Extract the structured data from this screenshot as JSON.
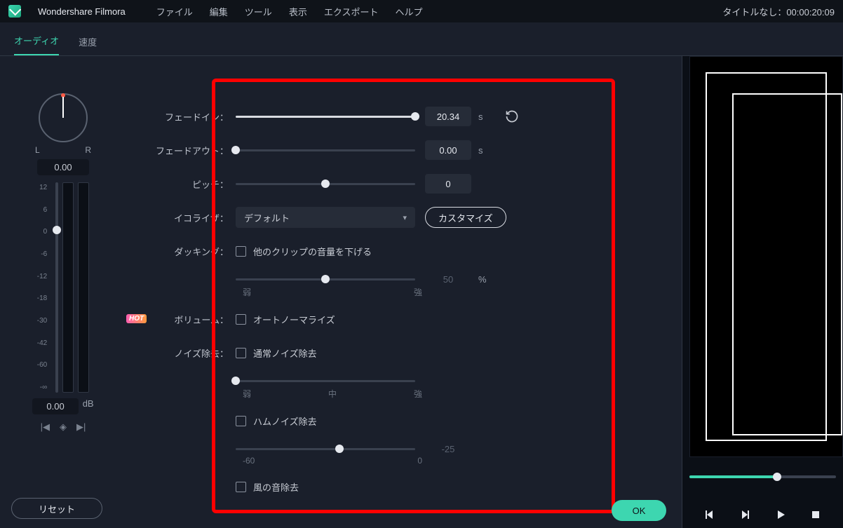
{
  "app": {
    "title": "Wondershare Filmora",
    "timecode": "タイトルなし：00:00:20:09"
  },
  "menu": {
    "file": "ファイル",
    "edit": "編集",
    "tool": "ツール",
    "view": "表示",
    "export": "エクスポート",
    "help": "ヘルプ"
  },
  "tabs": {
    "audio": "オーディオ",
    "speed": "速度"
  },
  "pan": {
    "l": "L",
    "r": "R",
    "value": "0.00"
  },
  "meter": {
    "ticks": [
      "12",
      "6",
      "0",
      "-6",
      "-12",
      "-18",
      "-30",
      "-42",
      "-60",
      "-∞"
    ],
    "value": "0.00",
    "unit": "dB"
  },
  "controls": {
    "fadein": {
      "label": "フェードイン：",
      "value": "20.34",
      "unit": "s"
    },
    "fadeout": {
      "label": "フェードアウト：",
      "value": "0.00",
      "unit": "s"
    },
    "pitch": {
      "label": "ピッチ：",
      "value": "0"
    },
    "equalizer": {
      "label": "イコライザ：",
      "value": "デフォルト",
      "customize": "カスタマイズ"
    },
    "ducking": {
      "label": "ダッキング：",
      "checkbox": "他のクリップの音量を下げる",
      "value": "50",
      "unit": "%",
      "weak": "弱",
      "strong": "強"
    },
    "volume": {
      "label": "ボリューム：",
      "hot": "HOT",
      "checkbox": "オートノーマライズ"
    },
    "denoise": {
      "label": "ノイズ除去：",
      "normal": "通常ノイズ除去",
      "weak": "弱",
      "mid": "中",
      "strong": "強",
      "hum": "ハムノイズ除去",
      "hum_value": "-25",
      "hum_min": "-60",
      "hum_max": "0",
      "wind": "風の音除去"
    }
  },
  "buttons": {
    "reset": "リセット",
    "ok": "OK"
  }
}
